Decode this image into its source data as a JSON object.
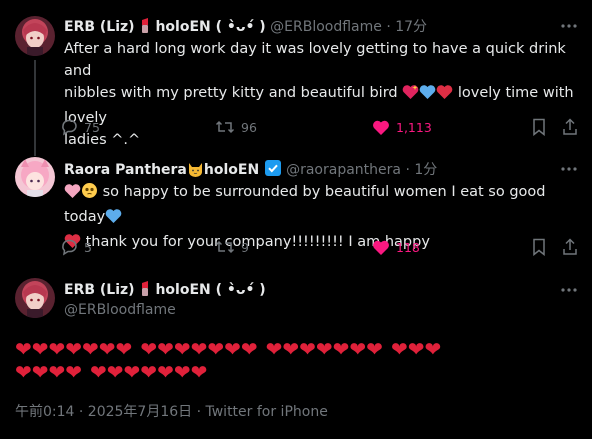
{
  "tweet1": {
    "display_name": "ERB (Liz)",
    "name_suffix": "holoEN ( •̀ᴗ•́ )",
    "handle": "@ERBloodflame",
    "time": "17分",
    "text_line1": "After a hard long work day it was lovely getting to have a quick drink and",
    "text_line2": "nibbles with my pretty kitty and beautiful bird",
    "text_line2_tail": "lovely time with lovely",
    "text_line3": "ladies ^.^",
    "reply_count": "75",
    "retweet_count": "96",
    "like_count": "1,113"
  },
  "tweet2": {
    "display_name": "Raora Panthera",
    "name_suffix": "holoEN",
    "handle": "@raorapanthera",
    "time": "1分",
    "text_line1": "so happy to be surrounded by beautiful women I eat so good today",
    "text_line2": "thank you for your company!!!!!!!!! I am happy",
    "reply_count": "5",
    "retweet_count": "9",
    "like_count": "118"
  },
  "tweet3": {
    "display_name": "ERB (Liz)",
    "name_suffix": "holoEN ( •̀ᴗ•́ )",
    "handle": "@ERBloodflame",
    "hearts": {
      "group1": "❤❤❤❤❤❤❤",
      "group2": "❤❤❤❤❤❤❤",
      "group3": "❤❤❤❤❤❤❤",
      "group4": "❤❤❤",
      "group5": "❤❤❤❤",
      "group6": "❤❤❤❤❤❤❤"
    },
    "meta": "午前0:14 · 2025年7月16日 · Twitter for iPhone"
  },
  "colors": {
    "background": "#000000",
    "text": "#e7e9ea",
    "muted": "#71767b",
    "like": "#f91880",
    "heart_red": "#e0213a",
    "verified": "#1d9bf0"
  },
  "icons": [
    "more-icon",
    "reply-icon",
    "retweet-icon",
    "like-icon",
    "bookmark-icon",
    "share-icon",
    "verified-icon",
    "lipstick-icon",
    "cat-icon"
  ]
}
